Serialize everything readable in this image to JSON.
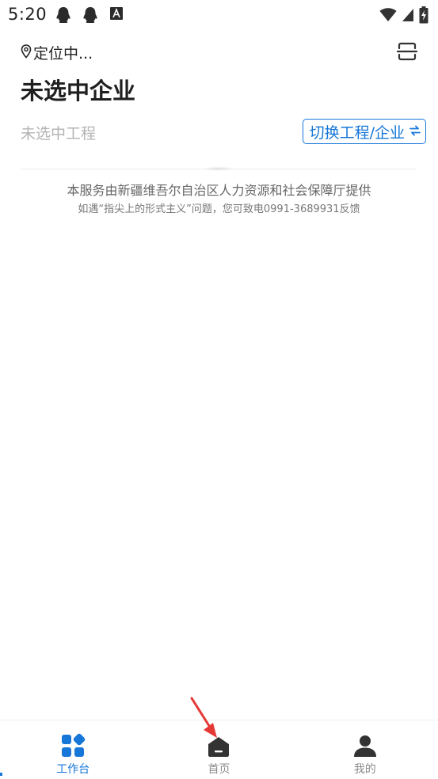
{
  "status_bar": {
    "time": "5:20",
    "left_icons": [
      "qq-icon",
      "qq-icon",
      "font-a-icon"
    ],
    "right_icons": [
      "wifi-icon",
      "signal-icon",
      "battery-charging-icon"
    ]
  },
  "header": {
    "location_label": "定位中...",
    "location_icon": "location-pin-icon",
    "scan_icon": "scan-icon",
    "company_title": "未选中企业",
    "project_placeholder": "未选中工程",
    "switch_label": "切换工程/企业",
    "switch_icon": "swap-arrows-icon"
  },
  "footer_note": {
    "line1": "本服务由新疆维吾尔自治区人力资源和社会保障厅提供",
    "line2": "如遇“指尖上的形式主义”问题，您可致电0991-3689931反馈"
  },
  "bottom_nav": {
    "items": [
      {
        "label": "工作台",
        "icon": "grid-apps-icon",
        "active": true
      },
      {
        "label": "首页",
        "icon": "home-icon",
        "active": false
      },
      {
        "label": "我的",
        "icon": "user-icon",
        "active": false
      }
    ]
  },
  "colors": {
    "accent": "#1677d9",
    "inactive_nav": "#8a8a8a",
    "placeholder": "#b3b3b3",
    "pointer": "#e53935"
  }
}
